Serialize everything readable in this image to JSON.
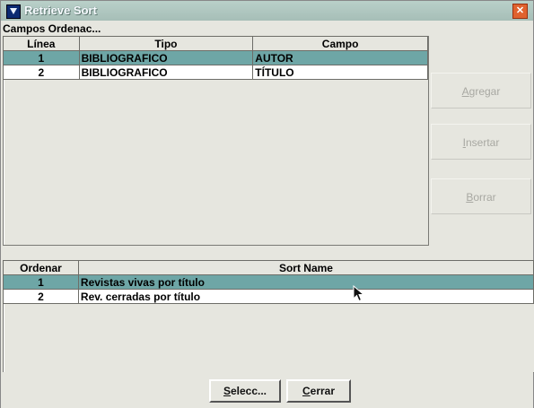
{
  "window": {
    "title": "Retrieve Sort"
  },
  "icons": {
    "app": "app-icon",
    "close": "close-icon",
    "cursor": "mouse-pointer-icon",
    "close_glyph": "✕"
  },
  "campos": {
    "label": "Campos Ordenac...",
    "headers": [
      "Línea",
      "Tipo",
      "Campo"
    ],
    "rows": [
      {
        "linea": "1",
        "tipo": "BIBLIOGRAFICO",
        "campo": "AUTOR",
        "selected": true
      },
      {
        "linea": "2",
        "tipo": "BIBLIOGRAFICO",
        "campo": "TÍTULO",
        "selected": false
      }
    ]
  },
  "side_buttons": {
    "agregar": "Agregar",
    "insertar": "Insertar",
    "borrar": "Borrar"
  },
  "sorts": {
    "headers": [
      "Ordenar",
      "Sort Name"
    ],
    "rows": [
      {
        "ordenar": "1",
        "name": "Revistas vivas por título",
        "selected": true
      },
      {
        "ordenar": "2",
        "name": "Rev. cerradas por título",
        "selected": false
      }
    ]
  },
  "footer": {
    "select_label": "Selecc...",
    "close_label": "Cerrar"
  },
  "colors": {
    "selection": "#6ea6a6",
    "window_bg": "#e6e6df",
    "title_bar": "#b0c8c1"
  }
}
